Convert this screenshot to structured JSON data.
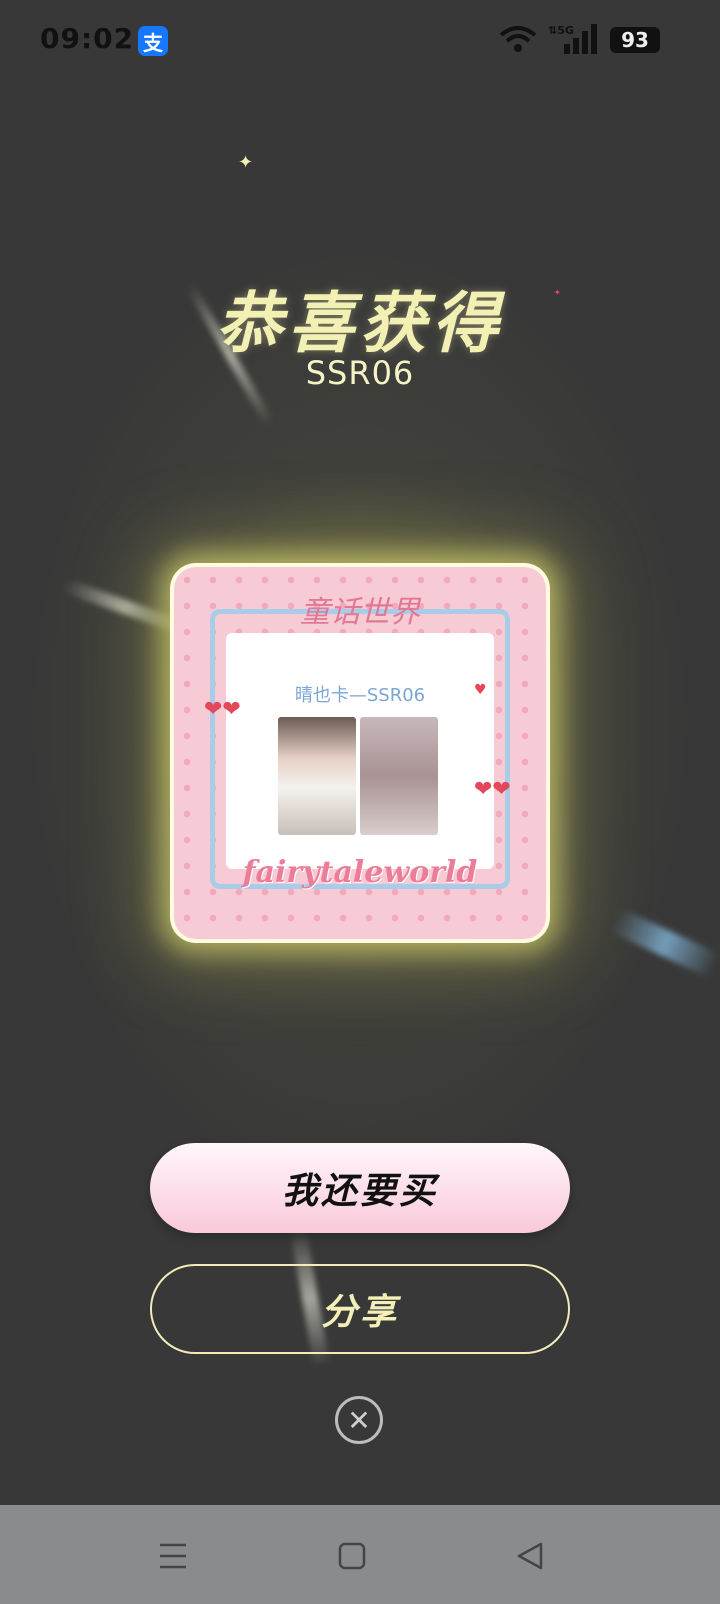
{
  "status_bar": {
    "time": "09:02",
    "app_icon": "支",
    "network": "5G",
    "battery": "93"
  },
  "result": {
    "title": "恭喜获得",
    "subtitle": "SSR06"
  },
  "card": {
    "brand_top": "童话世界",
    "label": "晴也卡—SSR06",
    "brand_bottom": "fairytaleworld"
  },
  "actions": {
    "buy_again": "我还要买",
    "share": "分享",
    "close": "✕"
  },
  "nav": {
    "menu_icon": "menu-icon",
    "home_icon": "home-icon",
    "back_icon": "back-icon"
  },
  "colors": {
    "title": "#f3f0b4",
    "card_pink": "#f7cbd6",
    "button_pink": "#f9c9da"
  }
}
